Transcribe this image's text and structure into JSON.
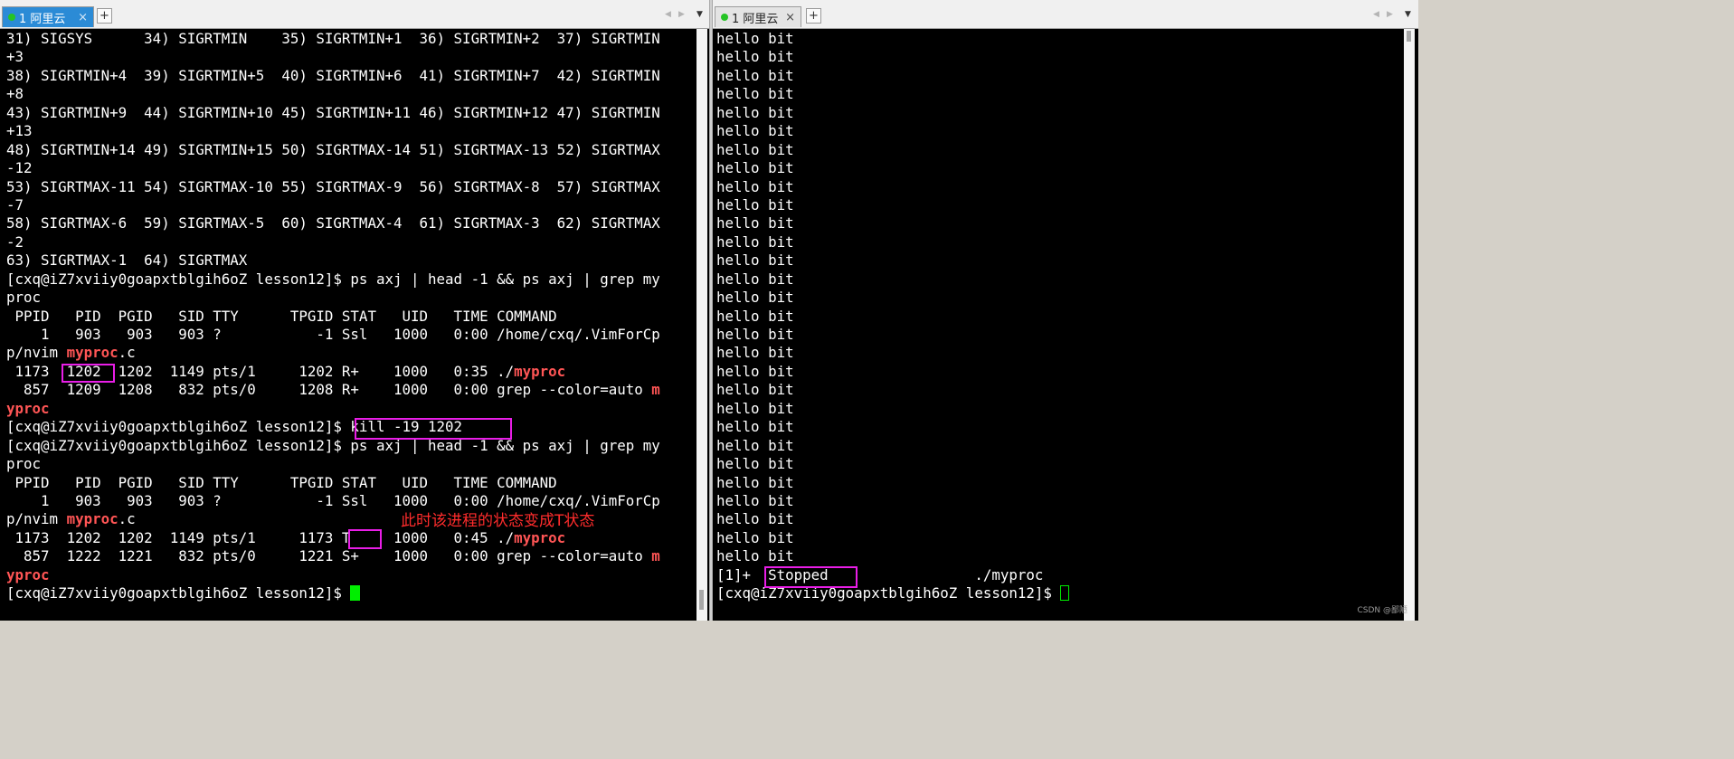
{
  "left_tab": {
    "title": "1 阿里云",
    "close": "×",
    "add": "+",
    "nav_prev": "◀",
    "nav_next": "▶",
    "dropdown": "▼"
  },
  "right_tab": {
    "title": "1 阿里云",
    "close": "×",
    "add": "+",
    "nav_prev": "◀",
    "nav_next": "▶",
    "dropdown": "▼"
  },
  "left_terminal": {
    "lines": [
      {
        "segments": [
          {
            "t": "31) SIGSYS      34) SIGRTMIN    35) SIGRTMIN+1  36) SIGRTMIN+2  37) SIGRTMIN"
          }
        ]
      },
      {
        "segments": [
          {
            "t": "+3"
          }
        ]
      },
      {
        "segments": [
          {
            "t": "38) SIGRTMIN+4  39) SIGRTMIN+5  40) SIGRTMIN+6  41) SIGRTMIN+7  42) SIGRTMIN"
          }
        ]
      },
      {
        "segments": [
          {
            "t": "+8"
          }
        ]
      },
      {
        "segments": [
          {
            "t": "43) SIGRTMIN+9  44) SIGRTMIN+10 45) SIGRTMIN+11 46) SIGRTMIN+12 47) SIGRTMIN"
          }
        ]
      },
      {
        "segments": [
          {
            "t": "+13"
          }
        ]
      },
      {
        "segments": [
          {
            "t": "48) SIGRTMIN+14 49) SIGRTMIN+15 50) SIGRTMAX-14 51) SIGRTMAX-13 52) SIGRTMAX"
          }
        ]
      },
      {
        "segments": [
          {
            "t": "-12"
          }
        ]
      },
      {
        "segments": [
          {
            "t": "53) SIGRTMAX-11 54) SIGRTMAX-10 55) SIGRTMAX-9  56) SIGRTMAX-8  57) SIGRTMAX"
          }
        ]
      },
      {
        "segments": [
          {
            "t": "-7"
          }
        ]
      },
      {
        "segments": [
          {
            "t": "58) SIGRTMAX-6  59) SIGRTMAX-5  60) SIGRTMAX-4  61) SIGRTMAX-3  62) SIGRTMAX"
          }
        ]
      },
      {
        "segments": [
          {
            "t": "-2"
          }
        ]
      },
      {
        "segments": [
          {
            "t": "63) SIGRTMAX-1  64) SIGRTMAX"
          }
        ]
      },
      {
        "segments": [
          {
            "t": "[cxq@iZ7xviiy0goapxtblgih6oZ lesson12]$ ps axj | head -1 && ps axj | grep my"
          }
        ]
      },
      {
        "segments": [
          {
            "t": "proc"
          }
        ]
      },
      {
        "segments": [
          {
            "t": " PPID   PID  PGID   SID TTY      TPGID STAT   UID   TIME COMMAND"
          }
        ]
      },
      {
        "segments": [
          {
            "t": "    1   903   903   903 ?           -1 Ssl   1000   0:00 /home/cxq/.VimForCp"
          }
        ]
      },
      {
        "segments": [
          {
            "t": "p/nvim "
          },
          {
            "t": "myproc",
            "hl": true
          },
          {
            "t": ".c"
          }
        ]
      },
      {
        "segments": [
          {
            "t": " 1173  1202  1202  1149 pts/1     1202 R+    1000   0:35 ./"
          },
          {
            "t": "myproc",
            "hl": true
          }
        ]
      },
      {
        "segments": [
          {
            "t": "  857  1209  1208   832 pts/0     1208 R+    1000   0:00 grep --color=auto "
          },
          {
            "t": "m",
            "hl": true
          }
        ]
      },
      {
        "segments": [
          {
            "t": "yproc",
            "hl": true
          }
        ]
      },
      {
        "segments": [
          {
            "t": "[cxq@iZ7xviiy0goapxtblgih6oZ lesson12]$ kill -19 1202"
          }
        ]
      },
      {
        "segments": [
          {
            "t": "[cxq@iZ7xviiy0goapxtblgih6oZ lesson12]$ ps axj | head -1 && ps axj | grep my"
          }
        ]
      },
      {
        "segments": [
          {
            "t": "proc"
          }
        ]
      },
      {
        "segments": [
          {
            "t": " PPID   PID  PGID   SID TTY      TPGID STAT   UID   TIME COMMAND"
          }
        ]
      },
      {
        "segments": [
          {
            "t": "    1   903   903   903 ?           -1 Ssl   1000   0:00 /home/cxq/.VimForCp"
          }
        ]
      },
      {
        "segments": [
          {
            "t": "p/nvim "
          },
          {
            "t": "myproc",
            "hl": true
          },
          {
            "t": ".c"
          }
        ]
      },
      {
        "segments": [
          {
            "t": " 1173  1202  1202  1149 pts/1     1173 T     1000   0:45 ./"
          },
          {
            "t": "myproc",
            "hl": true
          }
        ]
      },
      {
        "segments": [
          {
            "t": "  857  1222  1221   832 pts/0     1221 S+    1000   0:00 grep --color=auto "
          },
          {
            "t": "m",
            "hl": true
          }
        ]
      },
      {
        "segments": [
          {
            "t": "yproc",
            "hl": true
          }
        ]
      },
      {
        "segments": [
          {
            "t": "[cxq@iZ7xviiy0goapxtblgih6oZ lesson12]$ "
          }
        ],
        "cursor": "block"
      }
    ]
  },
  "right_terminal": {
    "lines": [
      {
        "segments": [
          {
            "t": "hello bit"
          }
        ]
      },
      {
        "segments": [
          {
            "t": "hello bit"
          }
        ]
      },
      {
        "segments": [
          {
            "t": "hello bit"
          }
        ]
      },
      {
        "segments": [
          {
            "t": "hello bit"
          }
        ]
      },
      {
        "segments": [
          {
            "t": "hello bit"
          }
        ]
      },
      {
        "segments": [
          {
            "t": "hello bit"
          }
        ]
      },
      {
        "segments": [
          {
            "t": "hello bit"
          }
        ]
      },
      {
        "segments": [
          {
            "t": "hello bit"
          }
        ]
      },
      {
        "segments": [
          {
            "t": "hello bit"
          }
        ]
      },
      {
        "segments": [
          {
            "t": "hello bit"
          }
        ]
      },
      {
        "segments": [
          {
            "t": "hello bit"
          }
        ]
      },
      {
        "segments": [
          {
            "t": "hello bit"
          }
        ]
      },
      {
        "segments": [
          {
            "t": "hello bit"
          }
        ]
      },
      {
        "segments": [
          {
            "t": "hello bit"
          }
        ]
      },
      {
        "segments": [
          {
            "t": "hello bit"
          }
        ]
      },
      {
        "segments": [
          {
            "t": "hello bit"
          }
        ]
      },
      {
        "segments": [
          {
            "t": "hello bit"
          }
        ]
      },
      {
        "segments": [
          {
            "t": "hello bit"
          }
        ]
      },
      {
        "segments": [
          {
            "t": "hello bit"
          }
        ]
      },
      {
        "segments": [
          {
            "t": "hello bit"
          }
        ]
      },
      {
        "segments": [
          {
            "t": "hello bit"
          }
        ]
      },
      {
        "segments": [
          {
            "t": "hello bit"
          }
        ]
      },
      {
        "segments": [
          {
            "t": "hello bit"
          }
        ]
      },
      {
        "segments": [
          {
            "t": "hello bit"
          }
        ]
      },
      {
        "segments": [
          {
            "t": "hello bit"
          }
        ]
      },
      {
        "segments": [
          {
            "t": "hello bit"
          }
        ]
      },
      {
        "segments": [
          {
            "t": "hello bit"
          }
        ]
      },
      {
        "segments": [
          {
            "t": "hello bit"
          }
        ]
      },
      {
        "segments": [
          {
            "t": "hello bit"
          }
        ]
      },
      {
        "segments": [
          {
            "t": "[1]+  Stopped                 ./myproc"
          }
        ]
      },
      {
        "segments": [
          {
            "t": "[cxq@iZ7xviiy0goapxtblgih6oZ lesson12]$ "
          }
        ],
        "cursor": "outline"
      }
    ]
  },
  "annotation": {
    "text": "此时该进程的状态变成T状态"
  },
  "watermark": {
    "text": "CSDN @鄙陋"
  },
  "colors": {
    "highlight": "#ff5555",
    "box": "#e91ee7",
    "annotation": "#ff2c2c",
    "cursor": "#00ee00",
    "tab_active": "#2b8bd6"
  }
}
